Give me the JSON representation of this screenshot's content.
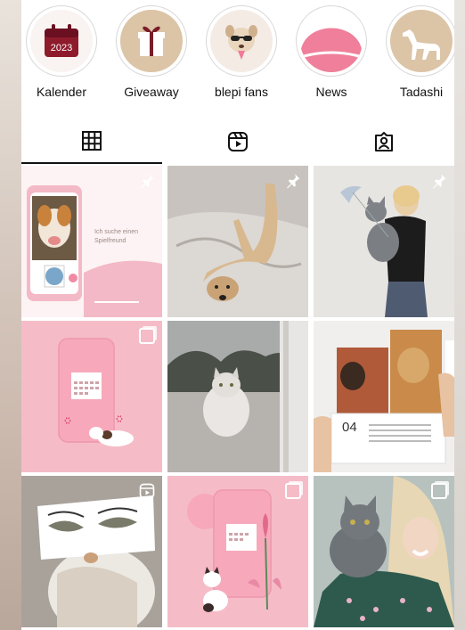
{
  "highlights": [
    {
      "label": "Kalender",
      "badge_text": "2023",
      "icon": "calendar-icon"
    },
    {
      "label": "Giveaway",
      "icon": "gift-icon"
    },
    {
      "label": "blepi fans",
      "icon": "dog-sunglasses-icon"
    },
    {
      "label": "News",
      "icon": "pink-cap-icon"
    },
    {
      "label": "Tadashi",
      "icon": "greyhound-icon"
    }
  ],
  "tabs": [
    {
      "name": "grid",
      "icon": "grid-icon",
      "active": true
    },
    {
      "name": "reels",
      "icon": "reels-icon",
      "active": false
    },
    {
      "name": "tagged",
      "icon": "tagged-person-icon",
      "active": false
    }
  ],
  "posts": {
    "post1": {
      "caption": "Ich suche einen Spielfreund",
      "badge": "pin"
    },
    "post2": {
      "badge": "pin"
    },
    "post3": {
      "badge": "pin"
    },
    "post4": {
      "badge": "multi"
    },
    "post5": {
      "badge": "none"
    },
    "post6": {
      "calendar_month": "04",
      "badge": "none"
    },
    "post7": {
      "badge": "reel"
    },
    "post8": {
      "badge": "multi"
    },
    "post9": {
      "badge": "multi"
    }
  },
  "colors": {
    "accent_pink": "#f4b9c6",
    "icon_dark": "#111111"
  }
}
